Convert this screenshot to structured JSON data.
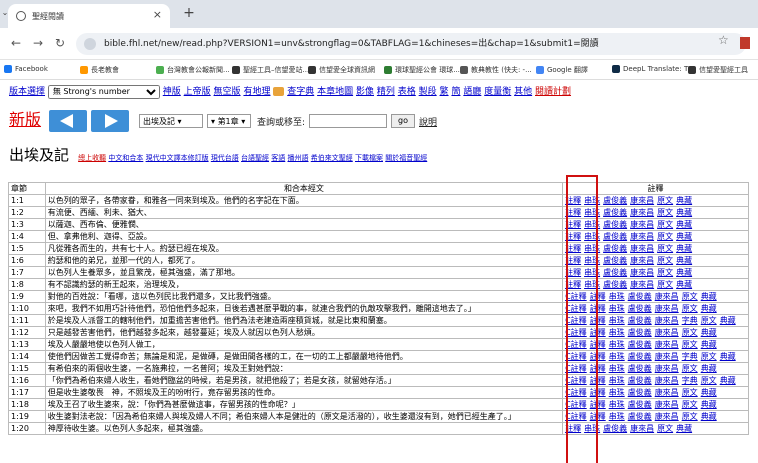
{
  "browser": {
    "tab_title": "聖經閱讀",
    "tab_close": "×",
    "new_tab": "+",
    "tab_dropdown": "⌄",
    "url": "bible.fhl.net/new/read.php?VERSION1=unv&strongflag=0&TABFLAG=1&chineses=出&chap=1&submit1=閱讀",
    "bookmarks": [
      {
        "label": "Facebook",
        "color": "#1877f2"
      },
      {
        "label": "長老教會",
        "color": "#ff9800"
      },
      {
        "label": "台灣教會公報新聞...",
        "color": "#4caf50"
      },
      {
        "label": "聖經工具–信望愛站...",
        "color": "#333333"
      },
      {
        "label": "信望愛全球資訊網",
        "color": "#333333"
      },
      {
        "label": "環球聖經公會 環球...",
        "color": "#2e7d32"
      },
      {
        "label": "教典教性 (快夫: -...",
        "color": "#555555"
      },
      {
        "label": "Google 翻譯",
        "color": "#4285f4"
      },
      {
        "label": "DeepL Translate: T...",
        "color": "#0f2b46"
      },
      {
        "label": "信望愛聖經工具",
        "color": "#333333"
      }
    ]
  },
  "toolbar": {
    "first_link": "版本選擇",
    "select_value": "無 Strong's number",
    "links": [
      "神版",
      "上帝版",
      "無空版",
      "有地理"
    ],
    "links2": [
      "查字典",
      "本章地圖",
      "影像",
      "精列",
      "表格",
      "製段",
      "繁",
      "簡",
      "語廳",
      "度量衡",
      "其他"
    ],
    "last_link": "閱讀計劃"
  },
  "nav": {
    "new_version": "新版",
    "book_select": "出埃及記",
    "chapter_select": "第1章",
    "query_label": "查詢或移至:",
    "go_label": "go",
    "help_link": "說明"
  },
  "book": {
    "name": "出埃及記",
    "versions": [
      "總上收聽",
      "中文和合本",
      "現代中文譯本修訂版",
      "現代台語",
      "台語聖經",
      "客語",
      "播州語",
      "希伯來文聖經",
      "下載檔案",
      "關於福音聖經"
    ]
  },
  "table": {
    "headers": [
      "章節",
      "和合本經文",
      "註釋"
    ],
    "rows": [
      {
        "ref": "1:1",
        "text": "以色列的眾子，各帶家眷，和雅各一同來到埃及。他們的名字記在下面。",
        "notes": [
          "註釋",
          "串珠",
          "盧俊義",
          "康來昌",
          "原文",
          "典藏"
        ]
      },
      {
        "ref": "1:2",
        "text": "有流便、西緬、利未、猶大、",
        "notes": [
          "註釋",
          "串珠",
          "盧俊義",
          "康來昌",
          "原文",
          "典藏"
        ]
      },
      {
        "ref": "1:3",
        "text": "以薩迦、西布倫、便雅憫、",
        "notes": [
          "註釋",
          "串珠",
          "盧俊義",
          "康來昌",
          "原文",
          "典藏"
        ]
      },
      {
        "ref": "1:4",
        "text": "但、拿弗他利、迦得、亞設。",
        "notes": [
          "註釋",
          "串珠",
          "盧俊義",
          "康來昌",
          "原文",
          "典藏"
        ]
      },
      {
        "ref": "1:5",
        "text": "凡從雅各而生的，共有七十人。約瑟已經在埃及。",
        "notes": [
          "註釋",
          "串珠",
          "盧俊義",
          "康來昌",
          "原文",
          "典藏"
        ]
      },
      {
        "ref": "1:6",
        "text": "約瑟和他的弟兄，並那一代的人，都死了。",
        "notes": [
          "註釋",
          "串珠",
          "盧俊義",
          "康來昌",
          "原文",
          "典藏"
        ]
      },
      {
        "ref": "1:7",
        "text": "以色列人生養眾多，並且繁茂，極其強盛，滿了那地。",
        "notes": [
          "註釋",
          "串珠",
          "盧俊義",
          "康來昌",
          "原文",
          "典藏"
        ]
      },
      {
        "ref": "1:8",
        "text": "有不認識約瑟的新王起來，治理埃及，",
        "notes": [
          "註釋",
          "串珠",
          "盧俊義",
          "康來昌",
          "原文",
          "典藏"
        ]
      },
      {
        "ref": "1:9",
        "text": "對他的百姓說：「看哪，這以色列民比我們還多，又比我們強盛。",
        "notes": [
          "C註釋",
          "註釋",
          "串珠",
          "盧俊義",
          "康來昌",
          "原文",
          "典藏"
        ]
      },
      {
        "ref": "1:10",
        "text": "來吧，我們不如用巧計待他們，恐怕他們多起來，日後若遇甚麼爭戰的事，就連合我們的仇敵攻擊我們，離開這地去了。」",
        "notes": [
          "C註釋",
          "註釋",
          "串珠",
          "盧俊義",
          "康來昌",
          "原文",
          "典藏"
        ]
      },
      {
        "ref": "1:11",
        "text": "於是埃及人派督工的轄制他們，加重擔苦害他們。他們為法老建造兩座積貨城，就是比東和蘭塞。",
        "notes": [
          "C註釋",
          "註釋",
          "串珠",
          "盧俊義",
          "康來昌",
          "字典",
          "原文",
          "典藏"
        ]
      },
      {
        "ref": "1:12",
        "text": "只是越發苦害他們，他們越發多起來，越發蔓延；埃及人就因以色列人愁煩。",
        "notes": [
          "C註釋",
          "註釋",
          "串珠",
          "盧俊義",
          "康來昌",
          "原文",
          "典藏"
        ]
      },
      {
        "ref": "1:13",
        "text": "埃及人嚴嚴地使以色列人做工，",
        "notes": [
          "C註釋",
          "註釋",
          "串珠",
          "盧俊義",
          "康來昌",
          "原文",
          "典藏"
        ]
      },
      {
        "ref": "1:14",
        "text": "使他們因做苦工覺得命苦；無論是和泥，是做磚，是做田間各樣的工，在一切的工上都嚴嚴地待他們。",
        "notes": [
          "C註釋",
          "註釋",
          "串珠",
          "盧俊義",
          "康來昌",
          "字典",
          "原文",
          "典藏"
        ]
      },
      {
        "ref": "1:15",
        "text": "有希伯來的兩個收生婆，一名施弗拉，一名普阿；埃及王對她們說：",
        "notes": [
          "C註釋",
          "註釋",
          "串珠",
          "盧俊義",
          "康來昌",
          "原文",
          "典藏"
        ]
      },
      {
        "ref": "1:16",
        "text": "「你們為希伯來婦人收生，看她們臨盆的時候，若是男孩，就把他殺了；若是女孩，就留她存活。」",
        "notes": [
          "C註釋",
          "註釋",
          "串珠",
          "盧俊義",
          "康來昌",
          "字典",
          "原文",
          "典藏"
        ]
      },
      {
        "ref": "1:17",
        "text": "但是收生婆敬畏　神，不照埃及王的吩咐行，竟存留男孩的性命。",
        "notes": [
          "C註釋",
          "註釋",
          "串珠",
          "盧俊義",
          "康來昌",
          "原文",
          "典藏"
        ]
      },
      {
        "ref": "1:18",
        "text": "埃及王召了收生婆來，說：「你們為甚麼做這事，存留男孩的性命呢？」",
        "notes": [
          "C註釋",
          "註釋",
          "串珠",
          "盧俊義",
          "康來昌",
          "原文",
          "典藏"
        ]
      },
      {
        "ref": "1:19",
        "text": "收生婆對法老說：「因為希伯來婦人與埃及婦人不同；希伯來婦人本是健壯的（原文是活潑的），收生婆還沒有到，她們已經生產了。」",
        "notes": [
          "C註釋",
          "註釋",
          "串珠",
          "盧俊義",
          "康來昌",
          "原文",
          "典藏"
        ]
      },
      {
        "ref": "1:20",
        "text": "神厚待收生婆。以色列人多起來，極其強盛。",
        "notes": [
          "註釋",
          "串珠",
          "盧俊義",
          "康來昌",
          "原文",
          "典藏"
        ]
      }
    ]
  }
}
